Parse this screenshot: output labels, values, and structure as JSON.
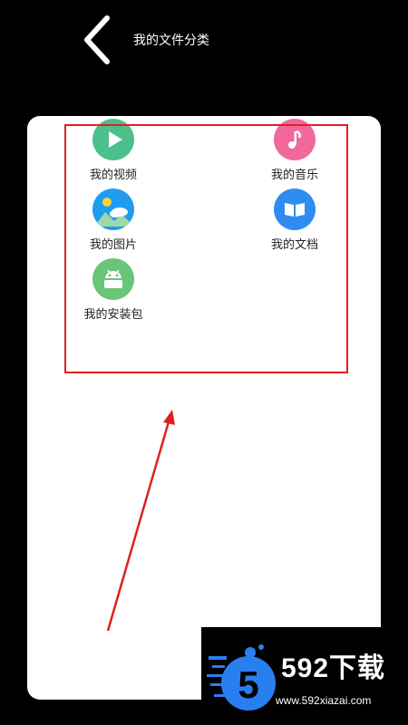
{
  "header": {
    "title": "我的文件分类",
    "back_icon": "chevron-left-icon"
  },
  "categories": [
    {
      "label": "我的视频",
      "icon": "play-icon",
      "color": "#4cc08a"
    },
    {
      "label": "我的音乐",
      "icon": "music-note-icon",
      "color": "#f0699a"
    },
    {
      "label": "我的图片",
      "icon": "picture-icon",
      "color": "#1e9cf0"
    },
    {
      "label": "我的文档",
      "icon": "book-icon",
      "color": "#2f8cf0"
    },
    {
      "label": "我的安装包",
      "icon": "android-package-icon",
      "color": "#6ac47a"
    }
  ],
  "annotation": {
    "color": "#e02020"
  },
  "watermark": {
    "brand": "592下载",
    "url": "www.592xiazai.com",
    "logo_char": "5",
    "logo_color": "#2a7ff0"
  }
}
